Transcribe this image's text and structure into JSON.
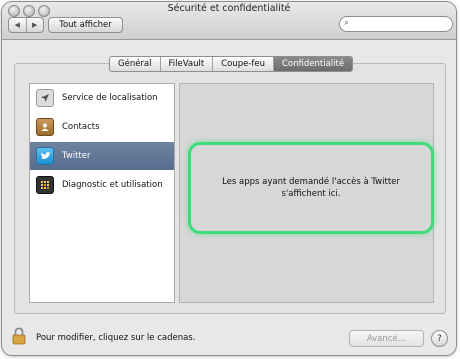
{
  "window": {
    "title": "Sécurité et confidentialité"
  },
  "toolbar": {
    "back_glyph": "◀",
    "forward_glyph": "▶",
    "show_all_label": "Tout afficher",
    "search": {
      "value": "",
      "placeholder": ""
    }
  },
  "tabs": [
    {
      "label": "Général",
      "selected": false
    },
    {
      "label": "FileVault",
      "selected": false
    },
    {
      "label": "Coupe-feu",
      "selected": false
    },
    {
      "label": "Confidentialité",
      "selected": true
    }
  ],
  "sidebar": {
    "items": [
      {
        "label": "Service de localisation",
        "icon": "location-arrow-icon",
        "selected": false
      },
      {
        "label": "Contacts",
        "icon": "contacts-book-icon",
        "selected": false
      },
      {
        "label": "Twitter",
        "icon": "twitter-bird-icon",
        "selected": true
      },
      {
        "label": "Diagnostic et utilisation",
        "icon": "diagnostics-grid-icon",
        "selected": false
      }
    ]
  },
  "detail": {
    "message": "Les apps ayant demandé l'accès à Twitter s'affichent ici."
  },
  "bottom": {
    "lock_text": "Pour modifier, cliquez sur le cadenas.",
    "advanced_label": "Avancé…",
    "help_label": "?"
  },
  "colors": {
    "selection": "#5d7393",
    "highlight_outline": "#3fdb7a"
  }
}
